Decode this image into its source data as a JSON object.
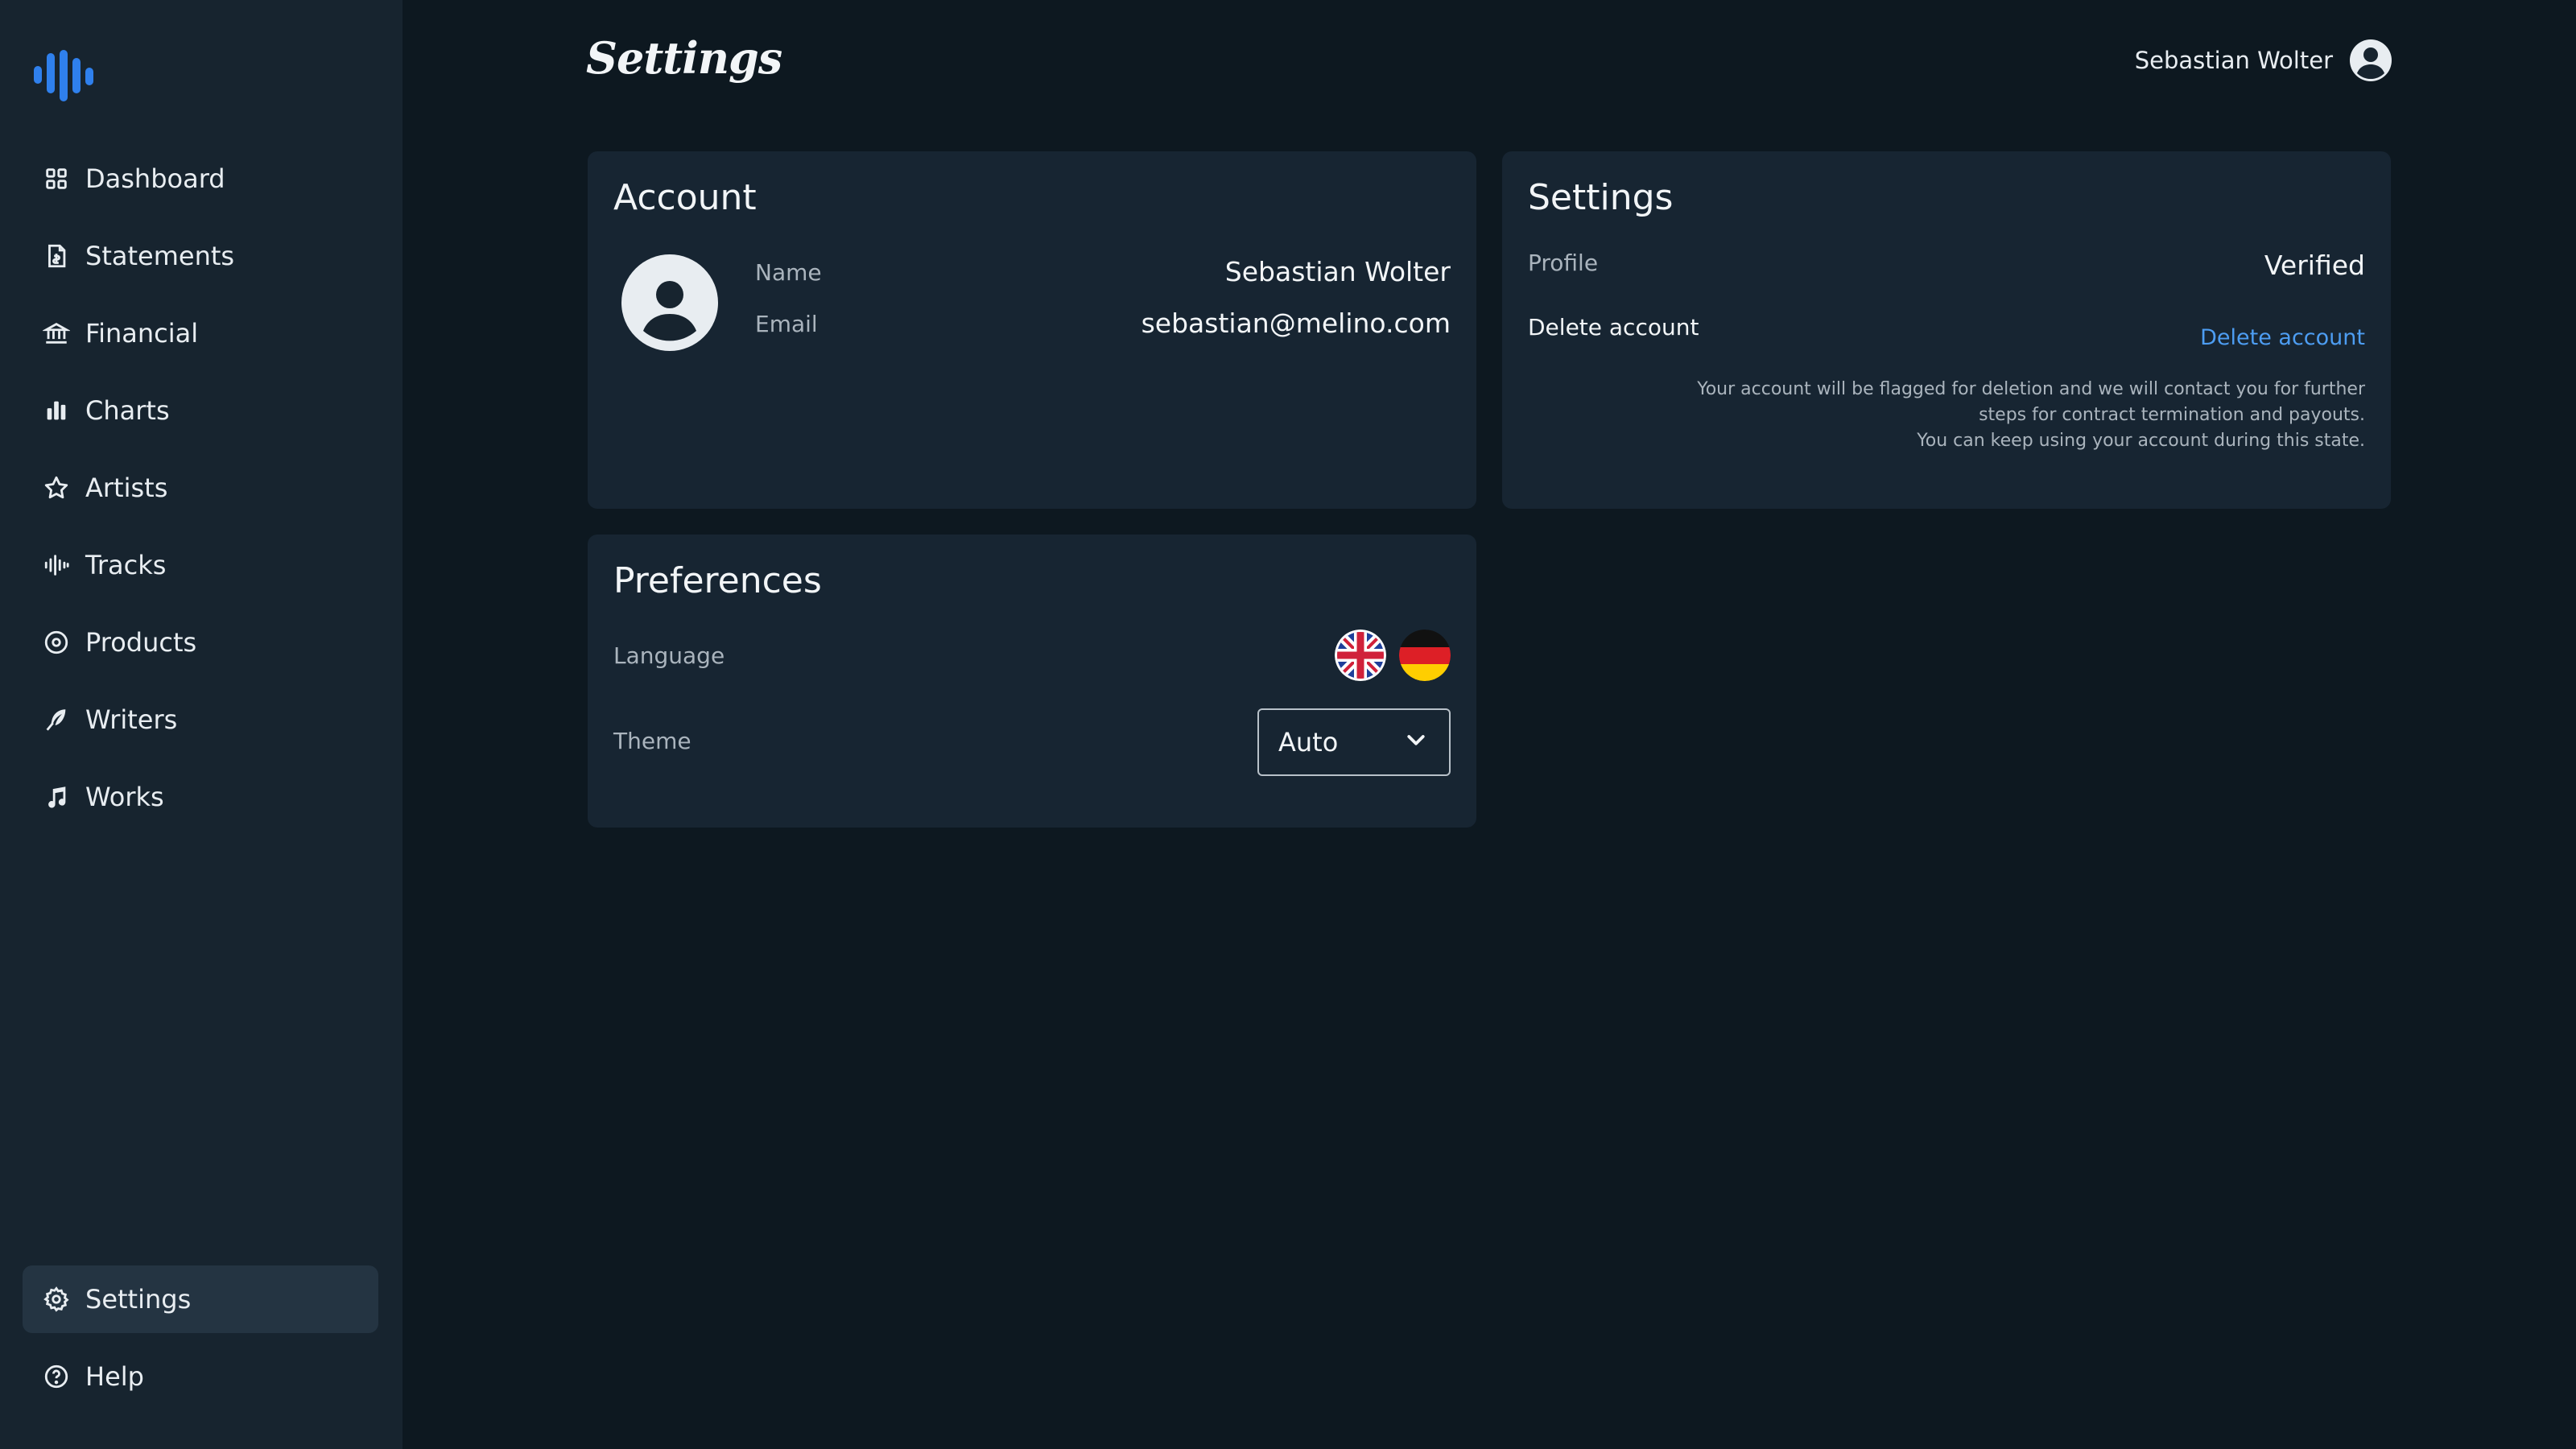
{
  "app": {
    "page_title": "Settings"
  },
  "sidebar": {
    "items": [
      {
        "label": "Dashboard",
        "icon": "dashboard-icon"
      },
      {
        "label": "Statements",
        "icon": "statement-icon"
      },
      {
        "label": "Financial",
        "icon": "bank-icon"
      },
      {
        "label": "Charts",
        "icon": "bar-chart-icon"
      },
      {
        "label": "Artists",
        "icon": "star-icon"
      },
      {
        "label": "Tracks",
        "icon": "waveform-icon"
      },
      {
        "label": "Products",
        "icon": "disc-icon"
      },
      {
        "label": "Writers",
        "icon": "feather-icon"
      },
      {
        "label": "Works",
        "icon": "music-note-icon"
      }
    ],
    "bottom_items": [
      {
        "label": "Settings",
        "icon": "gear-icon",
        "active": true
      },
      {
        "label": "Help",
        "icon": "help-icon"
      }
    ]
  },
  "header": {
    "user_name": "Sebastian Wolter"
  },
  "account": {
    "title": "Account",
    "name_label": "Name",
    "name_value": "Sebastian Wolter",
    "email_label": "Email",
    "email_value": "sebastian@melino.com"
  },
  "settings_card": {
    "title": "Settings",
    "profile_label": "Profile",
    "profile_value": "Verified",
    "delete_label": "Delete account",
    "delete_link": "Delete account",
    "delete_notice_line1": "Your account will be flagged for deletion and we will contact you for further",
    "delete_notice_line2": "steps for contract termination and payouts.",
    "delete_notice_line3": "You can keep using your account during this state."
  },
  "preferences": {
    "title": "Preferences",
    "language_label": "Language",
    "languages": [
      "uk-flag-icon",
      "germany-flag-icon"
    ],
    "theme_label": "Theme",
    "theme_value": "Auto"
  },
  "colors": {
    "background": "#0d1820",
    "sidebar": "#17242f",
    "card": "#172532",
    "accent": "#2f80ed",
    "link": "#4d9df2"
  }
}
